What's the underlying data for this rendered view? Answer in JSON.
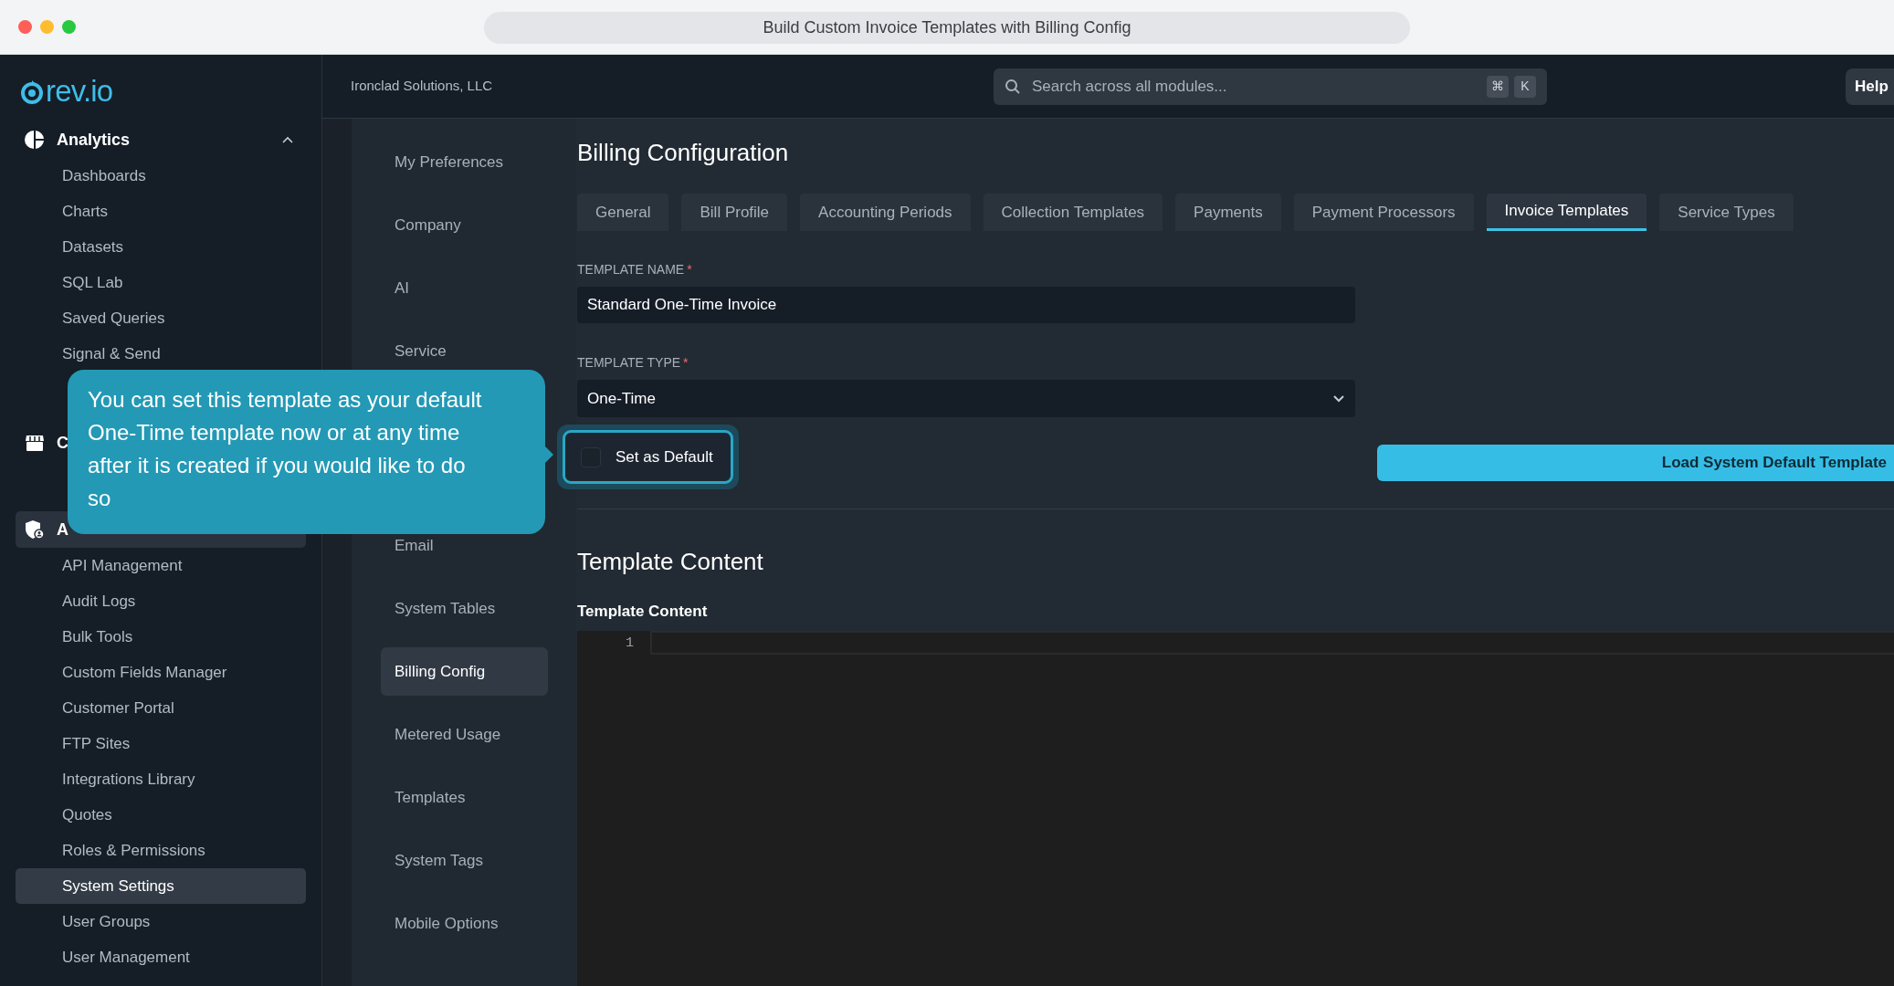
{
  "window": {
    "title": "Build Custom Invoice Templates with Billing Config"
  },
  "sidebar": {
    "logo": "rev.io",
    "sections": [
      {
        "label": "Analytics",
        "expanded": true,
        "selected": false,
        "items": [
          {
            "label": "Dashboards",
            "selected": false
          },
          {
            "label": "Charts",
            "selected": false
          },
          {
            "label": "Datasets",
            "selected": false
          },
          {
            "label": "SQL Lab",
            "selected": false
          },
          {
            "label": "Saved Queries",
            "selected": false
          },
          {
            "label": "Signal & Send",
            "selected": false
          }
        ]
      },
      {
        "label": "C",
        "selected": false
      },
      {
        "label": "A",
        "selected": true,
        "items": [
          {
            "label": "API Management",
            "selected": false
          },
          {
            "label": "Audit Logs",
            "selected": false
          },
          {
            "label": "Bulk Tools",
            "selected": false
          },
          {
            "label": "Custom Fields Manager",
            "selected": false
          },
          {
            "label": "Customer Portal",
            "selected": false
          },
          {
            "label": "FTP Sites",
            "selected": false
          },
          {
            "label": "Integrations Library",
            "selected": false
          },
          {
            "label": "Quotes",
            "selected": false
          },
          {
            "label": "Roles & Permissions",
            "selected": false
          },
          {
            "label": "System Settings",
            "selected": true
          },
          {
            "label": "User Groups",
            "selected": false
          },
          {
            "label": "User Management",
            "selected": false
          }
        ]
      }
    ]
  },
  "header": {
    "company": "Ironclad Solutions, LLC",
    "search": {
      "placeholder": "Search across all modules..."
    },
    "shortcut_keys": [
      "⌘",
      "K"
    ],
    "help": "Help"
  },
  "settings_nav": {
    "groups": [
      [
        {
          "label": "My Preferences",
          "selected": false
        },
        {
          "label": "Company",
          "selected": false
        },
        {
          "label": "AI",
          "selected": false
        },
        {
          "label": "Service",
          "selected": false
        }
      ],
      [
        {
          "label": "Email",
          "selected": false
        },
        {
          "label": "System Tables",
          "selected": false
        },
        {
          "label": "Billing Config",
          "selected": true
        },
        {
          "label": "Metered Usage",
          "selected": false
        },
        {
          "label": "Templates",
          "selected": false
        },
        {
          "label": "System Tags",
          "selected": false
        },
        {
          "label": "Mobile Options",
          "selected": false
        }
      ]
    ]
  },
  "main": {
    "title": "Billing Configuration",
    "tabs": [
      {
        "label": "General",
        "selected": false
      },
      {
        "label": "Bill Profile",
        "selected": false
      },
      {
        "label": "Accounting Periods",
        "selected": false
      },
      {
        "label": "Collection Templates",
        "selected": false
      },
      {
        "label": "Payments",
        "selected": false
      },
      {
        "label": "Payment Processors",
        "selected": false
      },
      {
        "label": "Invoice Templates",
        "selected": true
      },
      {
        "label": "Service Types",
        "selected": false
      }
    ],
    "template_name": {
      "label": "TEMPLATE NAME",
      "required_mark": "*",
      "value": "Standard One-Time Invoice"
    },
    "template_type": {
      "label": "TEMPLATE TYPE",
      "required_mark": "*",
      "value": "One-Time"
    },
    "set_default": {
      "label": "Set as Default",
      "checked": false,
      "highlighted": true
    },
    "load_button": "Load System Default Template",
    "section_title": "Template Content",
    "editor": {
      "label": "Template Content",
      "line_numbers": [
        "1"
      ]
    }
  },
  "tooltip": {
    "text": "You can set this template as your default One-Time template now or at any time after it is created if you would like to do so"
  }
}
